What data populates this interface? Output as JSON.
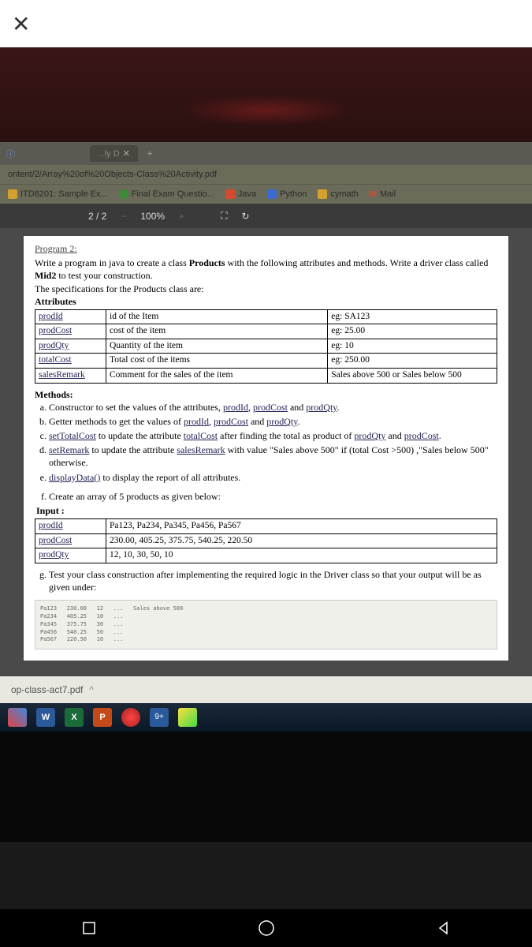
{
  "browser": {
    "tab_label": "...ly D",
    "url": "ontent/2/Array%20of%20Objects-Class%20Activity.pdf",
    "bookmarks": [
      {
        "label": "ITD8201: Sample Ex...",
        "icon_color": "#d4a030"
      },
      {
        "label": "Final Exam Questio...",
        "icon_color": "#3a8a3a"
      },
      {
        "label": "Java",
        "icon_color": "#d44a30"
      },
      {
        "label": "Python",
        "icon_color": "#3a6ad4"
      },
      {
        "label": "cymath",
        "icon_color": "#d4a030"
      },
      {
        "label": "Mail",
        "icon_color": "#d44a30"
      }
    ]
  },
  "pdf_toolbar": {
    "page": "2 / 2",
    "zoom": "100%"
  },
  "doc": {
    "title": "Program 2:",
    "intro_l1": "Write a program in java to create a class ",
    "intro_bold1": "Products",
    "intro_l2": " with the following attributes and methods. Write a driver class called ",
    "intro_bold2": "Mid2",
    "intro_l3": " to test your construction.",
    "spec_line": "The specifications for the Products class are:",
    "attributes_label": "Attributes",
    "attr_rows": [
      {
        "name": "prodId",
        "desc": "id of the Item",
        "eg": "eg: SA123"
      },
      {
        "name": "prodCost",
        "desc": "cost of the item",
        "eg": "eg: 25.00"
      },
      {
        "name": "prodQty",
        "desc": "Quantity of the item",
        "eg": "eg: 10"
      },
      {
        "name": "totalCost",
        "desc": "Total cost of the items",
        "eg": "eg: 250.00"
      },
      {
        "name": "salesRemark",
        "desc": "Comment for the sales of the item",
        "eg": "Sales above 500 or Sales below 500"
      }
    ],
    "methods_label": "Methods:",
    "methods": {
      "a": {
        "pre": "Constructor to set the values of the attributes, ",
        "u1": "prodId",
        "mid": ", ",
        "u2": "prodCost",
        "mid2": " and ",
        "u3": "prodQty",
        "post": "."
      },
      "b": {
        "pre": "Getter methods to get the values of ",
        "u1": "prodId",
        "mid": ", ",
        "u2": "prodCost",
        "mid2": " and ",
        "u3": "prodQty",
        "post": "."
      },
      "c": {
        "u1": "setTotalCost",
        "pre": " to update the attribute ",
        "u2": "totalCost",
        "mid": " after finding the total as product of ",
        "u3": "prodQty",
        "mid2": " and ",
        "u4": "prodCost",
        "post": "."
      },
      "d": {
        "u1": "setRemark",
        "pre": " to update the attribute ",
        "u2": "salesRemark",
        "mid": " with value \"Sales above 500\" if (total Cost >500) ,\"Sales below 500\" otherwise."
      },
      "e": {
        "u1": "displayData()",
        "pre": " to display the report of all attributes."
      },
      "f": "Create an array of 5 products as given below:",
      "g": "Test your class construction after implementing the required logic in the Driver class so that your output will be as given under:"
    },
    "input_label": "Input :",
    "input_rows": [
      {
        "name": "prodId",
        "vals": "Pa123, Pa234, Pa345, Pa456, Pa567"
      },
      {
        "name": "prodCost",
        "vals": "230.00, 405.25, 375.75, 540.25, 220.50"
      },
      {
        "name": "prodQty",
        "vals": "12, 10, 30, 50, 10"
      }
    ],
    "output_text": "Pa123   230.00   12   ...   Sales above 500\nPa234   405.25   10   ...\nPa345   375.75   30   ...\nPa456   540.25   50   ...\nPa567   220.50   10   ..."
  },
  "downloads": {
    "file": "op-class-act7.pdf"
  }
}
